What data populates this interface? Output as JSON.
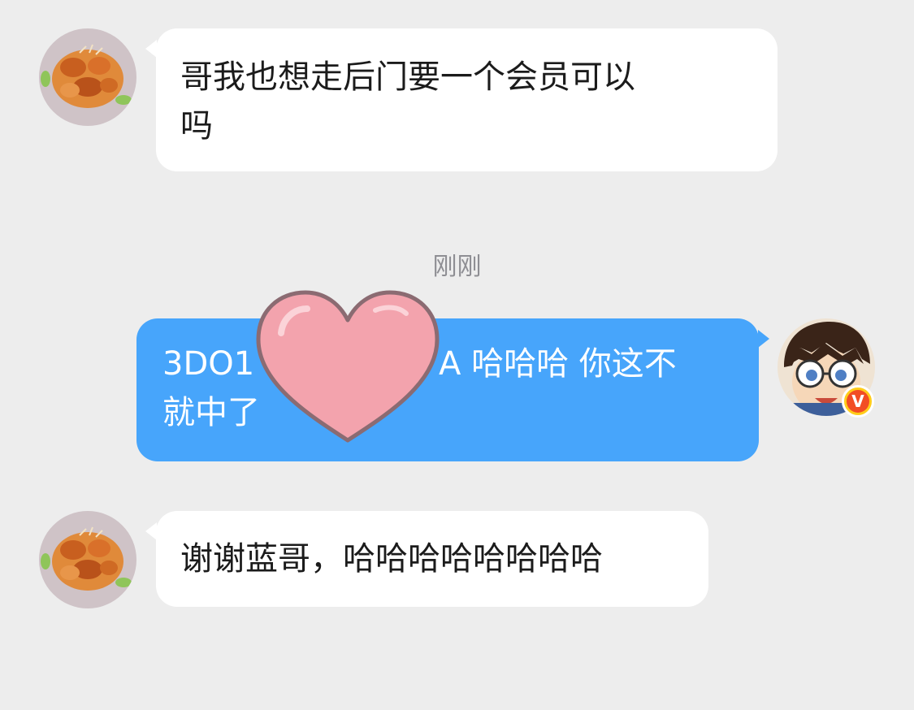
{
  "messages": [
    {
      "sender": "other",
      "text_line1": "哥我也想走后门要一个会员可以",
      "text_line2": "吗"
    },
    {
      "sender": "self",
      "text_line1_start": "3DO1",
      "text_line1_end": "A 哈哈哈 你这不",
      "text_line2": "就中了"
    },
    {
      "sender": "other",
      "text_line1": "谢谢蓝哥，哈哈哈哈哈哈哈哈"
    }
  ],
  "timestamp": "刚刚",
  "badge": {
    "label": "V"
  },
  "colors": {
    "background": "#ededed",
    "incoming_bubble": "#ffffff",
    "outgoing_bubble": "#47a5fb",
    "timestamp_text": "#8e8e93",
    "heart": "#f3a3ad",
    "badge_outer": "#ffcc1a",
    "badge_inner": "#f24d24"
  },
  "icons": [
    "sticker-heart-icon",
    "vip-badge-icon"
  ]
}
